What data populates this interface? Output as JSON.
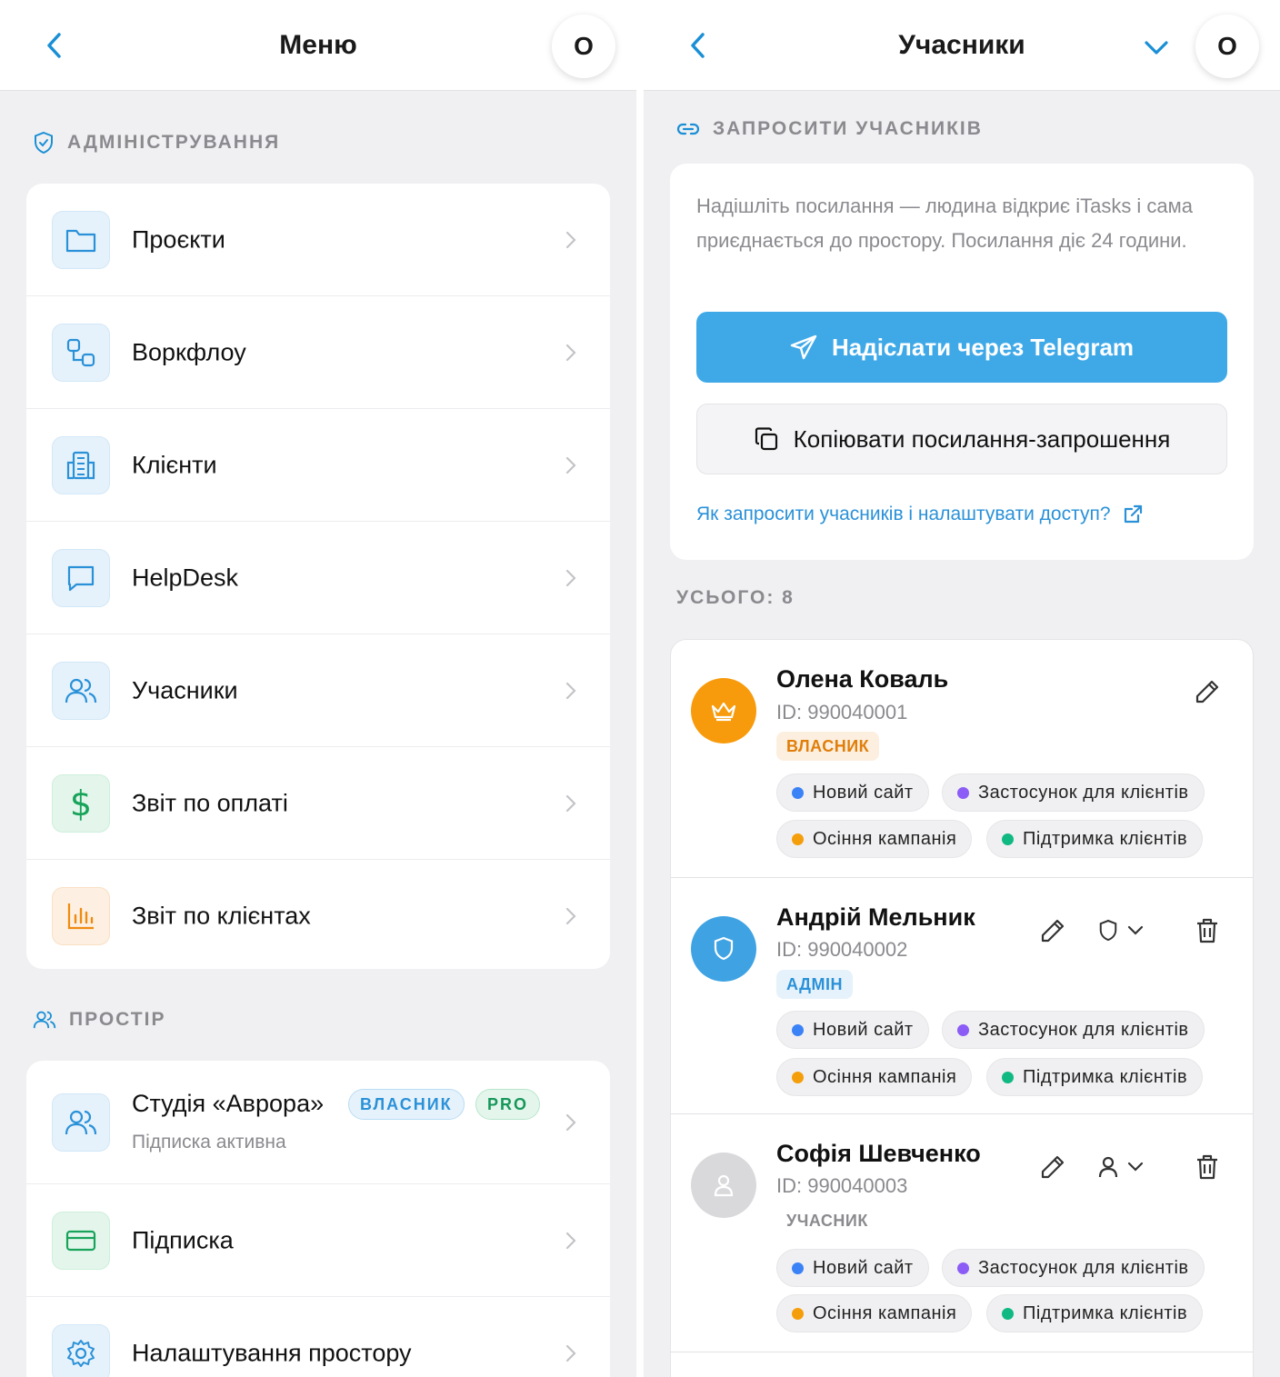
{
  "left": {
    "title": "Меню",
    "avatar_letter": "O",
    "admin_section": "АДМІНІСТРУВАННЯ",
    "admin_items": [
      {
        "label": "Проєкти",
        "icon": "folder-icon"
      },
      {
        "label": "Воркфлоу",
        "icon": "workflow-icon"
      },
      {
        "label": "Клієнти",
        "icon": "building-icon"
      },
      {
        "label": "HelpDesk",
        "icon": "chat-icon"
      },
      {
        "label": "Учасники",
        "icon": "users-icon"
      },
      {
        "label": "Звіт по оплаті",
        "icon": "dollar-icon"
      },
      {
        "label": "Звіт по клієнтах",
        "icon": "bar-chart-icon"
      }
    ],
    "space_section": "ПРОСТІР",
    "studio": {
      "name": "Студія «Аврора»",
      "badge_owner": "ВЛАСНИК",
      "badge_plan": "PRO",
      "subtitle": "Підписка активна"
    },
    "space_items": [
      {
        "label": "Підписка",
        "icon": "credit-card-icon"
      },
      {
        "label": "Налаштування простору",
        "icon": "gear-icon"
      }
    ]
  },
  "right": {
    "title": "Учасники",
    "avatar_letter": "O",
    "invite_section": "ЗАПРОСИТИ УЧАСНИКІВ",
    "invite_text": "Надішліть посилання — людина відкриє iTasks і сама приєднається до простору. Посилання діє 24 години.",
    "telegram_button": "Надіслати через Telegram",
    "copy_button": "Копіювати посилання-запрошення",
    "help_link": "Як запросити учасників і налаштувати доступ?",
    "total_label": "УСЬОГО: 8",
    "projects": [
      {
        "name": "Новий сайт",
        "color": "#3b82f6"
      },
      {
        "name": "Застосунок для клієнтів",
        "color": "#8b5cf6"
      },
      {
        "name": "Осіння кампанія",
        "color": "#f59e0b"
      },
      {
        "name": "Підтримка клієнтів",
        "color": "#10b981"
      }
    ],
    "members": [
      {
        "name": "Олена Коваль",
        "id": "ID: 990040001",
        "role": "ВЛАСНИК",
        "avatar_icon": "crown-icon"
      },
      {
        "name": "Андрій Мельник",
        "id": "ID: 990040002",
        "role": "АДМІН",
        "avatar_icon": "shield-icon"
      },
      {
        "name": "Софія Шевченко",
        "id": "ID: 990040003",
        "role": "УЧАСНИК",
        "avatar_icon": "user-icon"
      }
    ]
  },
  "colors": {
    "accent": "#1a8fd6",
    "telegram": "#3fa9e8",
    "owner_orange": "#f79b0c",
    "admin_blue": "#3fa3e3",
    "member_gray": "#d9d9dc"
  }
}
